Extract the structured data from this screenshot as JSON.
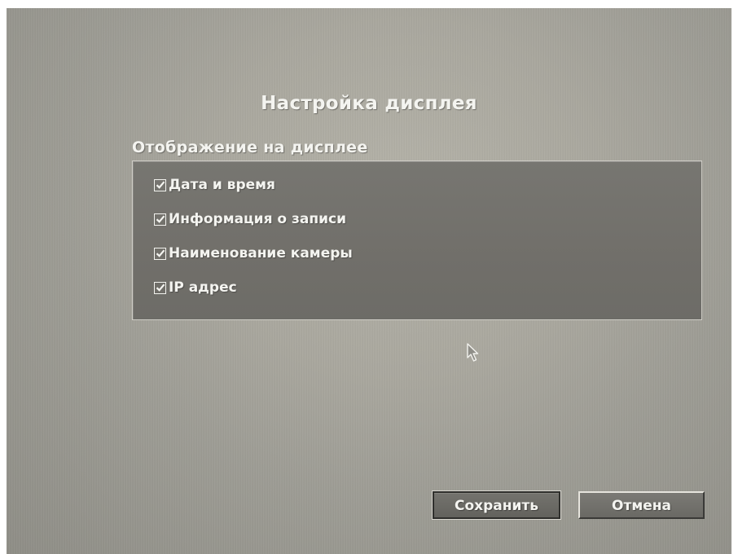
{
  "dialog": {
    "title": "Настройка дисплея",
    "section_label": "Отображение на дисплее"
  },
  "options": [
    {
      "label": "Дата и время",
      "checked": true
    },
    {
      "label": "Информация о записи",
      "checked": true
    },
    {
      "label": "Наименование камеры",
      "checked": true
    },
    {
      "label": "IP адрес",
      "checked": true
    }
  ],
  "buttons": {
    "save_label": "Сохранить",
    "cancel_label": "Отмена"
  },
  "icons": {
    "checkbox": "checkbox-checked-icon",
    "cursor": "mouse-pointer-icon"
  }
}
